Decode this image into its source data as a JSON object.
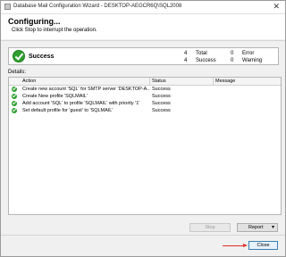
{
  "window": {
    "title": "Database Mail Configuration Wizard - DESKTOP-AEGCR6Q\\SQL2008",
    "close_glyph": "✕",
    "icon": "wizard-app-icon"
  },
  "header": {
    "title": "Configuring...",
    "subtitle": "Click Stop to interrupt the operation."
  },
  "status": {
    "label": "Success",
    "total_count": "4",
    "total_label": "Total",
    "success_count": "4",
    "success_label": "Success",
    "error_count": "0",
    "error_label": "Error",
    "warning_count": "0",
    "warning_label": "Warning"
  },
  "details": {
    "label": "Details:",
    "columns": [
      "Action",
      "Status",
      "Message"
    ],
    "rows": [
      {
        "action": "Create new account 'SQL' for SMTP server 'DESKTOP-A...",
        "status": "Success",
        "message": ""
      },
      {
        "action": "Create New profile 'SQLMAIL'",
        "status": "Success",
        "message": ""
      },
      {
        "action": "Add account 'SQL' to profile 'SQLMAIL' with priority '1'",
        "status": "Success",
        "message": ""
      },
      {
        "action": "Set default profile for 'guest' to 'SQLMAIL'",
        "status": "Success",
        "message": ""
      }
    ]
  },
  "buttons": {
    "stop": "Stop",
    "report": "Report",
    "close": "Close"
  },
  "colors": {
    "success_green": "#2fa02f",
    "annotation_red": "#e0302a",
    "focus_blue": "#3c7fb1"
  }
}
